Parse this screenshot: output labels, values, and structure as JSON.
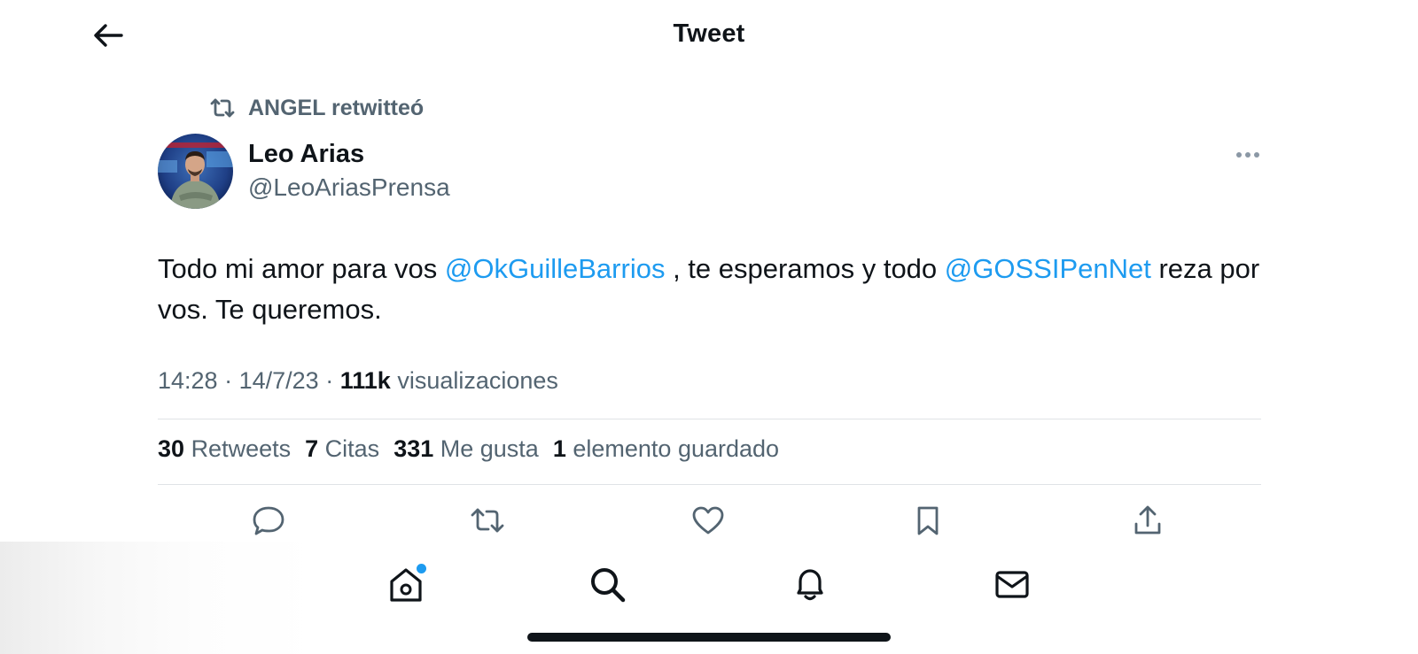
{
  "header": {
    "title": "Tweet"
  },
  "retweet_context": {
    "label": "ANGEL retwitteó"
  },
  "tweet": {
    "author_name": "Leo Arias",
    "author_handle": "@LeoAriasPrensa",
    "text_parts": [
      "Todo mi amor para vos ",
      "@OkGuilleBarrios",
      " , te esperamos y todo ",
      "@GOSSIPenNet",
      " reza por vos. Te queremos."
    ],
    "time": "14:28",
    "date": "14/7/23",
    "separator": "·",
    "views_count": "111k",
    "views_label": "visualizaciones"
  },
  "stats": {
    "retweets_count": "30",
    "retweets_label": "Retweets",
    "quotes_count": "7",
    "quotes_label": "Citas",
    "likes_count": "331",
    "likes_label": "Me gusta",
    "bookmarks_count": "1",
    "bookmarks_label": "elemento guardado"
  },
  "actions": [
    "reply-icon",
    "retweet-icon",
    "like-icon",
    "bookmark-icon",
    "share-icon"
  ],
  "bottom_nav": [
    "home-icon",
    "search-icon",
    "notifications-icon",
    "messages-icon"
  ],
  "colors": {
    "accent": "#1d9bf0",
    "text_primary": "#0f1419",
    "text_secondary": "#536471",
    "divider": "#dfe3e6"
  }
}
